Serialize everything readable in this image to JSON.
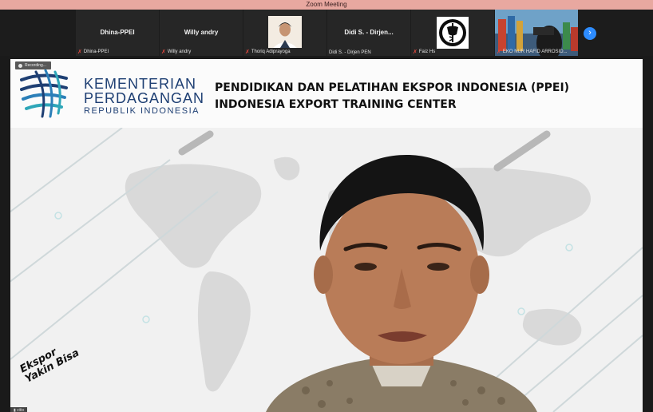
{
  "window": {
    "title": "Zoom Meeting"
  },
  "participants": [
    {
      "center_name": "Dhina-PPEI",
      "label": "Dhina-PPEI",
      "muted": true,
      "has_video": false
    },
    {
      "center_name": "Willy andry",
      "label": "Willy andry",
      "muted": true,
      "has_video": false
    },
    {
      "center_name": "",
      "label": "Thoriq Adiprayoga",
      "muted": true,
      "has_video": true
    },
    {
      "center_name": "Didi S. - Dirjen...",
      "label": "Didi S. - Dirjen PEN",
      "muted": false,
      "has_video": false
    },
    {
      "center_name": "",
      "label": "Faiz Hs",
      "muted": true,
      "has_video": true
    },
    {
      "center_name": "",
      "label": "EKO NUR HAFID ARROSID...",
      "muted": true,
      "has_video": true
    }
  ],
  "controls": {
    "next_icon": "chevron-right-icon",
    "next_symbol": "›"
  },
  "main_video": {
    "recording_label": "Recording...",
    "ministry": {
      "line1": "KEMENTERIAN",
      "line2": "PERDAGANGAN",
      "line3": "REPUBLIK INDONESIA"
    },
    "heading": {
      "line1": "PENDIDIKAN  DAN PELATIHAN EKSPOR INDONESIA (PPEI)",
      "line2": "INDONESIA EXPORT TRAINING CENTER"
    },
    "slogan": {
      "line1": "Ekspor",
      "line2": "Yakin Bisa"
    },
    "network_label": "vitto"
  },
  "colors": {
    "brand_blue": "#1e3f73",
    "zoom_blue": "#2d8cff",
    "mute_red": "#e0483e",
    "titlebar": "#e8a8a0"
  }
}
